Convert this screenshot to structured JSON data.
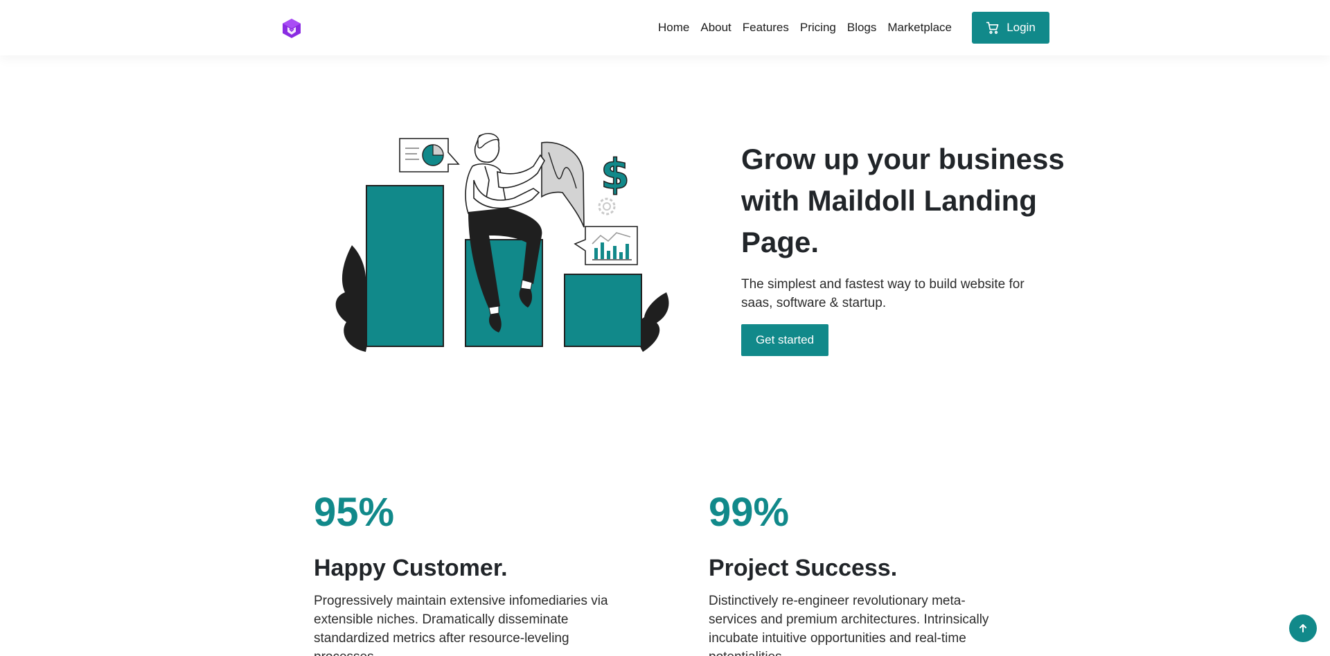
{
  "colors": {
    "accent": "#11898a",
    "brand_logo": "#8a2be2",
    "text": "#212529"
  },
  "header": {
    "logo_icon": "cube-logo-icon",
    "nav": [
      {
        "label": "Home"
      },
      {
        "label": "About"
      },
      {
        "label": "Features"
      },
      {
        "label": "Pricing"
      },
      {
        "label": "Blogs"
      },
      {
        "label": "Marketplace"
      }
    ],
    "login": {
      "label": "Login",
      "icon": "cart-icon"
    }
  },
  "hero": {
    "title": "Grow up your business with Maildoll Landing Page.",
    "subtitle": "The simplest and fastest way to build website for saas, software & startup.",
    "cta_label": "Get started",
    "illustration": "business-growth-illustration",
    "dollar_symbol": "$"
  },
  "stats": [
    {
      "value": "95%",
      "label": "Happy Customer.",
      "description": "Progressively maintain extensive infomediaries via extensible niches. Dramatically disseminate standardized metrics after resource-leveling processes."
    },
    {
      "value": "99%",
      "label": "Project Success.",
      "description": "Distinctively re-engineer revolutionary meta-services and premium architectures. Intrinsically incubate intuitive opportunities and real-time potentialities."
    }
  ],
  "scroll_top_icon": "arrow-up-icon"
}
